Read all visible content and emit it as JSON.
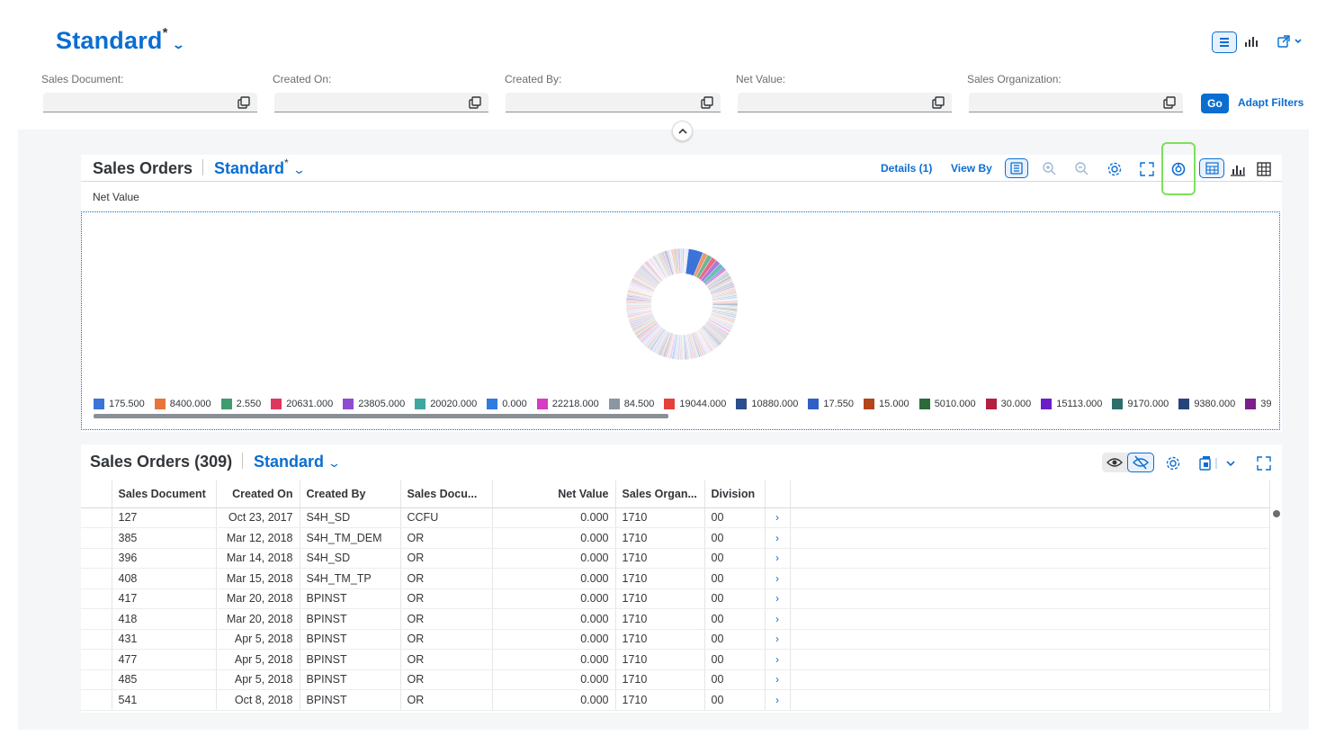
{
  "header": {
    "variant_title": "Standard",
    "variant_modified_mark": "*"
  },
  "filters": [
    {
      "label": "Sales Document:",
      "value": ""
    },
    {
      "label": "Created On:",
      "value": ""
    },
    {
      "label": "Created By:",
      "value": ""
    },
    {
      "label": "Net Value:",
      "value": ""
    },
    {
      "label": "Sales Organization:",
      "value": ""
    }
  ],
  "filter_actions": {
    "go": "Go",
    "adapt": "Adapt Filters"
  },
  "chart_card": {
    "title": "Sales Orders",
    "variant": "Standard",
    "variant_modified_mark": "*",
    "details": "Details (1)",
    "view_by": "View By",
    "measure_label": "Net Value"
  },
  "chart_data": {
    "type": "pie",
    "subtype": "donut",
    "measure": "Net Value",
    "slice_count_visible_in_legend": 17,
    "legend": [
      {
        "label": "175.500",
        "color": "#3b73d9"
      },
      {
        "label": "8400.000",
        "color": "#e8743b"
      },
      {
        "label": "2.550",
        "color": "#3f9c6e"
      },
      {
        "label": "20631.000",
        "color": "#e0365c"
      },
      {
        "label": "23805.000",
        "color": "#8e4cd1"
      },
      {
        "label": "20020.000",
        "color": "#3fa7a0"
      },
      {
        "label": "0.000",
        "color": "#2f7be0"
      },
      {
        "label": "22218.000",
        "color": "#d63cc4"
      },
      {
        "label": "84.500",
        "color": "#8a96a3"
      },
      {
        "label": "19044.000",
        "color": "#e6413a"
      },
      {
        "label": "10880.000",
        "color": "#2b4e8c"
      },
      {
        "label": "17.550",
        "color": "#3160c4"
      },
      {
        "label": "15.000",
        "color": "#b3441c"
      },
      {
        "label": "5010.000",
        "color": "#2a6b3a"
      },
      {
        "label": "30.000",
        "color": "#b51e3c"
      },
      {
        "label": "15113.000",
        "color": "#6a1fc9"
      },
      {
        "label": "9170.000",
        "color": "#2e6e6a"
      },
      {
        "label": "9380.000",
        "color": "#25457a"
      },
      {
        "label": "39",
        "color": "#7a1f8c"
      }
    ]
  },
  "table": {
    "title": "Sales Orders (309)",
    "variant": "Standard",
    "columns": [
      "Sales Document",
      "Created On",
      "Created By",
      "Sales Docu...",
      "Net Value",
      "Sales Organ...",
      "Division"
    ],
    "rows": [
      [
        "127",
        "Oct 23, 2017",
        "S4H_SD",
        "CCFU",
        "0.000",
        "1710",
        "00"
      ],
      [
        "385",
        "Mar 12, 2018",
        "S4H_TM_DEM",
        "OR",
        "0.000",
        "1710",
        "00"
      ],
      [
        "396",
        "Mar 14, 2018",
        "S4H_SD",
        "OR",
        "0.000",
        "1710",
        "00"
      ],
      [
        "408",
        "Mar 15, 2018",
        "S4H_TM_TP",
        "OR",
        "0.000",
        "1710",
        "00"
      ],
      [
        "417",
        "Mar 20, 2018",
        "BPINST",
        "OR",
        "0.000",
        "1710",
        "00"
      ],
      [
        "418",
        "Mar 20, 2018",
        "BPINST",
        "OR",
        "0.000",
        "1710",
        "00"
      ],
      [
        "431",
        "Apr 5, 2018",
        "BPINST",
        "OR",
        "0.000",
        "1710",
        "00"
      ],
      [
        "477",
        "Apr 5, 2018",
        "BPINST",
        "OR",
        "0.000",
        "1710",
        "00"
      ],
      [
        "485",
        "Apr 5, 2018",
        "BPINST",
        "OR",
        "0.000",
        "1710",
        "00"
      ],
      [
        "541",
        "Oct 8, 2018",
        "BPINST",
        "OR",
        "0.000",
        "1710",
        "00"
      ]
    ]
  },
  "colors": {
    "accent": "#0a6ed1",
    "highlight_box": "#7ce05a",
    "page_background": "#f5f6f7"
  }
}
